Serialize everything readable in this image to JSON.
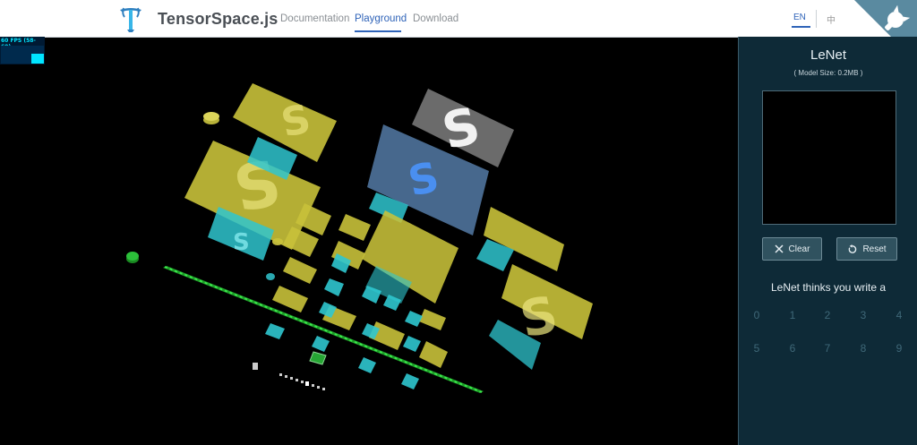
{
  "nav": {
    "brand": "TensorSpace.js",
    "links": [
      "Documentation",
      "Playground",
      "Download"
    ],
    "active": "Playground",
    "lang_en": "EN",
    "lang_zh": "中"
  },
  "fps": {
    "label": "60 FPS (58-60)"
  },
  "panel": {
    "model_name": "LeNet",
    "model_size": "( Model Size: 0.2MB )",
    "clear_label": "Clear",
    "reset_label": "Reset",
    "prediction_title": "LeNet thinks you write a",
    "digits": [
      "0",
      "1",
      "2",
      "3",
      "4",
      "5",
      "6",
      "7",
      "8",
      "9"
    ]
  },
  "colors": {
    "accent": "#2f63b8",
    "panel_bg": "#0e2a37",
    "layer_yellow": "#c8c13a",
    "layer_cyan": "#2fc6cf",
    "dense_green": "#22c433",
    "input_gray": "#6b6b6b"
  },
  "visualization": {
    "input_digit_glyph": "S"
  }
}
